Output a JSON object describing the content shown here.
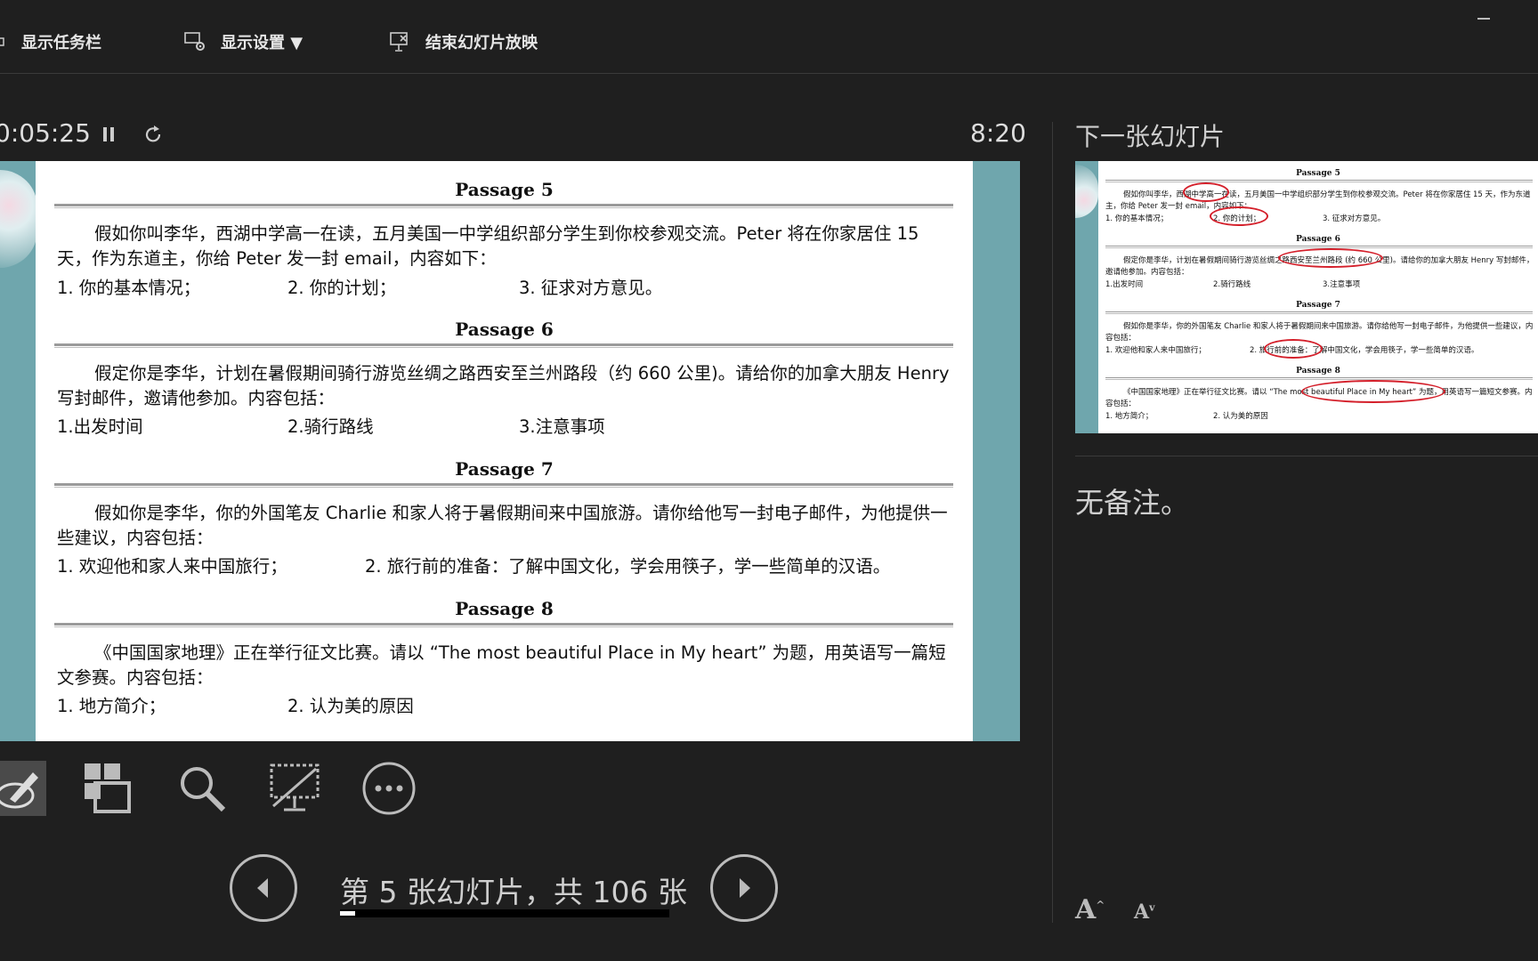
{
  "toolbar": {
    "show_taskbar": "显示任务栏",
    "display_settings": "显示设置 ▼",
    "end_show": "结束幻灯片放映"
  },
  "presenter": {
    "elapsed": "0:05:25",
    "clock": "8:20",
    "next_label": "下一张幻灯片",
    "notes": "无备注。",
    "slide_counter": "第 5 张幻灯片，共 106 张",
    "progress_fraction": 0.047
  },
  "slide": {
    "passages": [
      {
        "title": "Passage 5",
        "text": "假如你叫李华，西湖中学高一在读，五月美国一中学组织部分学生到你校参观交流。Peter 将在你家居住 15 天，作为东道主，你给 Peter 发一封 email，内容如下：",
        "items": [
          "1. 你的基本情况；",
          "2. 你的计划；",
          "3. 征求对方意见。"
        ]
      },
      {
        "title": "Passage 6",
        "text": "假定你是李华，计划在暑假期间骑行游览丝绸之路西安至兰州路段（约 660 公里)。请给你的加拿大朋友 Henry 写封邮件，邀请他参加。内容包括：",
        "items": [
          "1.出发时间",
          "2.骑行路线",
          "3.注意事项"
        ]
      },
      {
        "title": "Passage 7",
        "text": "假如你是李华，你的外国笔友 Charlie 和家人将于暑假期间来中国旅游。请你给他写一封电子邮件，为他提供一些建议，内容包括：",
        "items": [
          "1. 欢迎他和家人来中国旅行；",
          "2. 旅行前的准备：了解中国文化，学会用筷子，学一些简单的汉语。"
        ]
      },
      {
        "title": "Passage 8",
        "text": "《中国国家地理》正在举行征文比赛。请以 “The most beautiful Place in My heart” 为题，用英语写一篇短文参赛。内容包括：",
        "items": [
          "1. 地方简介；",
          "2. 认为美的原因"
        ]
      }
    ]
  },
  "next_slide": {
    "passages": [
      {
        "title": "Passage 5",
        "text": "假如你叫李华，西湖中学高一在读，五月美国一中学组织部分学生到你校参观交流。Peter 将在你家居住 15 天，作为东道主，你给 Peter 发一封 email，内容如下：",
        "items": [
          "1. 你的基本情况；",
          "2. 你的计划；",
          "3. 征求对方意见。"
        ]
      },
      {
        "title": "Passage 6",
        "text": "假定你是李华，计划在暑假期间骑行游览丝绸之路西安至兰州路段 (约 660 公里)。请给你的加拿大朋友 Henry 写封邮件，邀请他参加。内容包括：",
        "items": [
          "1.出发时间",
          "2.骑行路线",
          "3.注意事项"
        ]
      },
      {
        "title": "Passage 7",
        "text": "假如你是李华，你的外国笔友 Charlie 和家人将于暑假期间来中国旅游。请你给他写一封电子邮件，为他提供一些建议，内容包括：",
        "items": [
          "1. 欢迎他和家人来中国旅行；",
          "2. 旅行前的准备：了解中国文化，学会用筷子，学一些简单的汉语。"
        ]
      },
      {
        "title": "Passage 8",
        "text": "《中国国家地理》正在举行征文比赛。请以 “The most beautiful Place in My heart” 为题，用英语写一篇短文参赛。内容包括：",
        "items": [
          "1. 地方简介；",
          "2. 认为美的原因"
        ]
      }
    ]
  },
  "icons": [
    "taskbar-icon",
    "display-settings-icon",
    "end-show-icon",
    "pause-icon",
    "restart-icon",
    "pen-icon",
    "slides-grid-icon",
    "zoom-icon",
    "black-screen-icon",
    "more-icon",
    "prev-icon",
    "next-icon",
    "font-increase-icon",
    "font-decrease-icon"
  ],
  "font_buttons": {
    "increase": "A",
    "decrease": "A"
  },
  "colors": {
    "background": "#1f1f1f",
    "slide_teal": "#6fa6ad",
    "annotation_red": "#d41f2a"
  }
}
